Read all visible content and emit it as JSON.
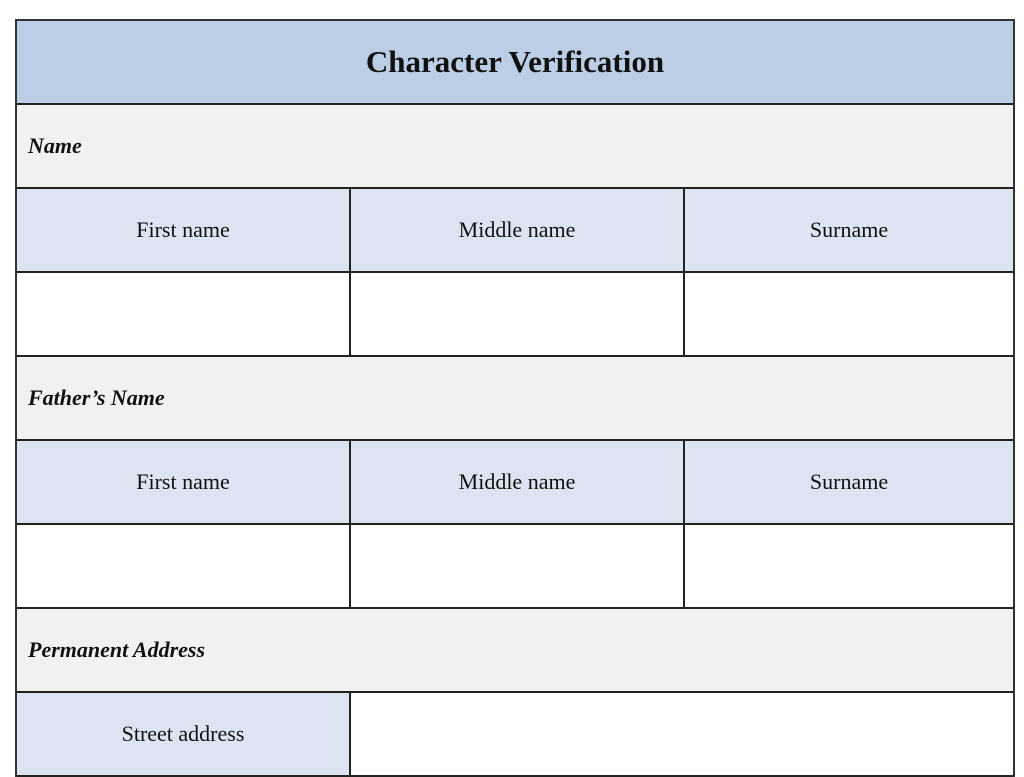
{
  "form": {
    "title": "Character Verification",
    "sections": [
      {
        "label": "Name",
        "columns": [
          "First name",
          "Middle name",
          "Surname"
        ],
        "values": [
          "",
          "",
          ""
        ]
      },
      {
        "label": "Father’s Name",
        "columns": [
          "First name",
          "Middle name",
          "Surname"
        ],
        "values": [
          "",
          "",
          ""
        ]
      },
      {
        "label": "Permanent Address",
        "fields": [
          {
            "label": "Street address",
            "value": ""
          }
        ]
      }
    ]
  },
  "colors": {
    "title_bg": "#bccee6",
    "section_bg": "#f1f1f1",
    "header_bg": "#dbe4f0",
    "border": "#222222"
  }
}
